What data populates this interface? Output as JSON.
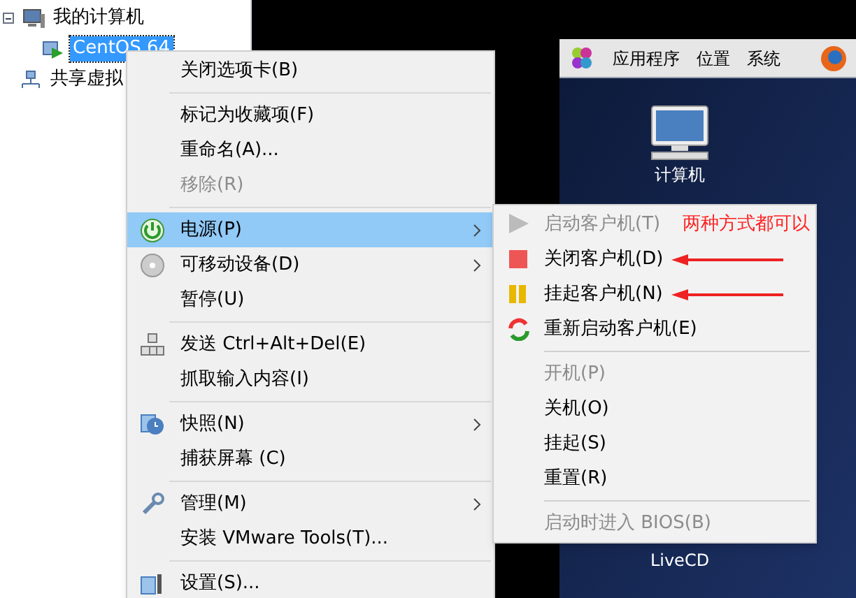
{
  "tree": [
    {
      "label": "我的计算机",
      "selected": false,
      "children": [
        {
          "label": "CentOS 64",
          "selected": true
        }
      ]
    },
    {
      "label": "共享虚拟",
      "selected": false
    }
  ],
  "guest": {
    "panel_menus": [
      "应用程序",
      "位置",
      "系统"
    ],
    "desktop_icons": [
      "计算机",
      "LiveCD"
    ]
  },
  "context_menu": {
    "groups": [
      [
        {
          "label": "关闭选项卡(B)",
          "disabled": false,
          "selected": false,
          "submenu": false
        }
      ],
      [
        {
          "label": "标记为收藏项(F)",
          "disabled": false,
          "selected": false,
          "submenu": false
        },
        {
          "label": "重命名(A)...",
          "disabled": false,
          "selected": false,
          "submenu": false
        },
        {
          "label": "移除(R)",
          "disabled": true,
          "selected": false,
          "submenu": false
        }
      ],
      [
        {
          "label": "电源(P)",
          "disabled": false,
          "selected": true,
          "submenu": true
        },
        {
          "label": "可移动设备(D)",
          "disabled": false,
          "selected": false,
          "submenu": true
        },
        {
          "label": "暂停(U)",
          "disabled": false,
          "selected": false,
          "submenu": false
        }
      ],
      [
        {
          "label": "发送 Ctrl+Alt+Del(E)",
          "disabled": false,
          "selected": false,
          "submenu": false
        },
        {
          "label": "抓取输入内容(I)",
          "disabled": false,
          "selected": false,
          "submenu": false
        }
      ],
      [
        {
          "label": "快照(N)",
          "disabled": false,
          "selected": false,
          "submenu": true
        },
        {
          "label": "捕获屏幕 (C)",
          "disabled": false,
          "selected": false,
          "submenu": false
        }
      ],
      [
        {
          "label": "管理(M)",
          "disabled": false,
          "selected": false,
          "submenu": true
        },
        {
          "label": "安装 VMware Tools(T)...",
          "disabled": false,
          "selected": false,
          "submenu": false
        }
      ],
      [
        {
          "label": "设置(S)...",
          "disabled": false,
          "selected": false,
          "submenu": false
        }
      ]
    ]
  },
  "power_submenu": {
    "groups": [
      [
        {
          "label": "启动客户机(T)",
          "disabled": true,
          "annotated": false
        },
        {
          "label": "关闭客户机(D)",
          "disabled": false,
          "annotated": true
        },
        {
          "label": "挂起客户机(N)",
          "disabled": false,
          "annotated": true
        },
        {
          "label": "重新启动客户机(E)",
          "disabled": false,
          "annotated": false
        }
      ],
      [
        {
          "label": "开机(P)",
          "disabled": true,
          "annotated": false
        },
        {
          "label": "关机(O)",
          "disabled": false,
          "annotated": false
        },
        {
          "label": "挂起(S)",
          "disabled": false,
          "annotated": false
        },
        {
          "label": "重置(R)",
          "disabled": false,
          "annotated": false
        }
      ],
      [
        {
          "label": "启动时进入 BIOS(B)",
          "disabled": true,
          "annotated": false
        }
      ]
    ]
  },
  "annotation": {
    "note": "两种方式都可以"
  }
}
